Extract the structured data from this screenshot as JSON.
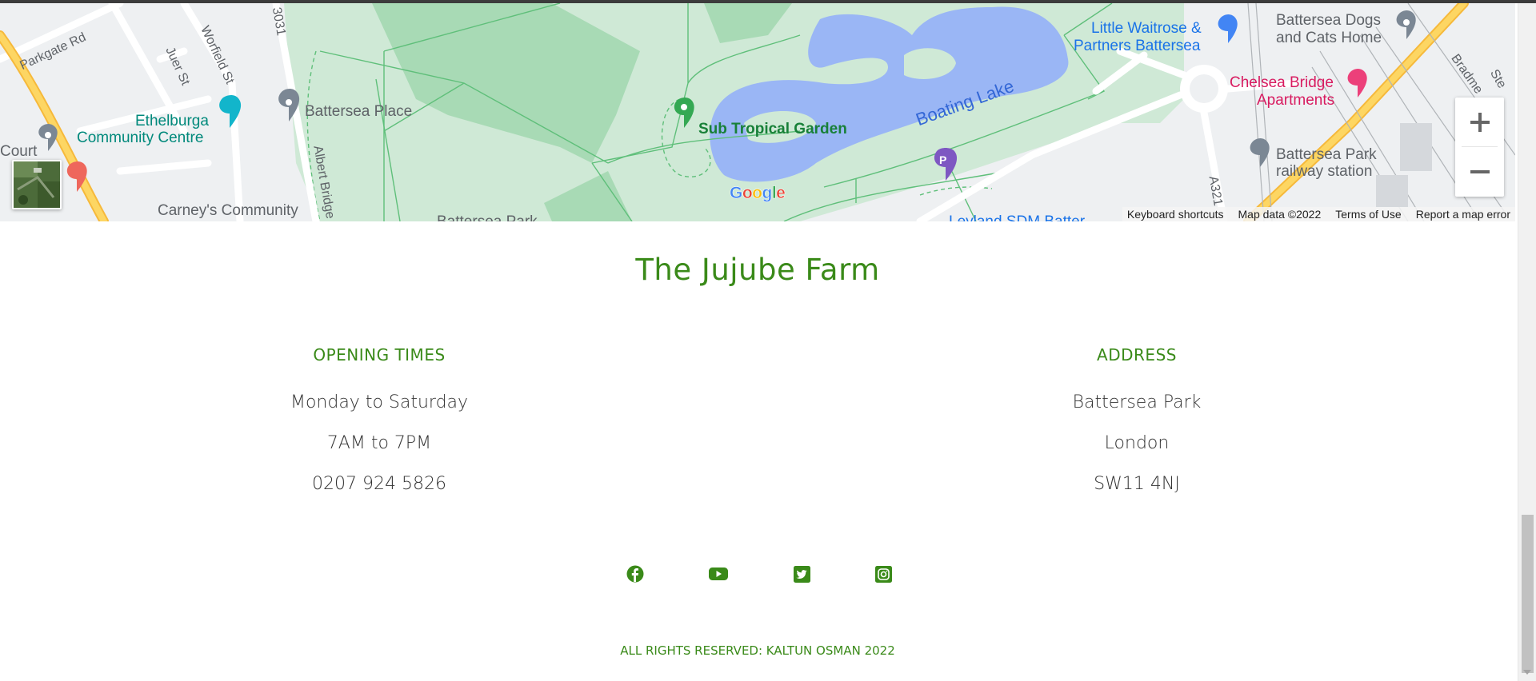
{
  "map": {
    "labels": {
      "parkgate": "Parkgate Rd",
      "juer": "Juer St",
      "worfield": "Worfield St",
      "b3031": "3031",
      "battersea_place": "Battersea Place",
      "ethelburga_1": "Ethelburga",
      "ethelburga_2": "Community Centre",
      "court": "Court",
      "albert_bridge": "Albert Bridge",
      "carneys": "Carney's Community",
      "battersea_park_cut": "Battersea Park",
      "sub_tropical": "Sub Tropical Garden",
      "boating_lake": "Boating Lake",
      "waitrose_1": "Little Waitrose &",
      "waitrose_2": "Partners Battersea",
      "dogs_cats_1": "Battersea Dogs",
      "dogs_cats_2": "and Cats Home",
      "chelsea_bridge_1": "Chelsea Bridge",
      "chelsea_bridge_2": "Apartments",
      "rail_1": "Battersea Park",
      "rail_2": "railway station",
      "a3216": "A321",
      "bradmead": "Bradme",
      "ste": "Ste",
      "leyland": "Leyland SDM Batter",
      "parking": "P"
    },
    "google_logo": [
      "G",
      "o",
      "o",
      "g",
      "l",
      "e"
    ],
    "google_colors": [
      "#4285F4",
      "#EA4335",
      "#FBBC05",
      "#4285F4",
      "#34A853",
      "#EA4335"
    ],
    "attribution": {
      "keyboard": "Keyboard shortcuts",
      "map_data": "Map data ©2022",
      "terms": "Terms of Use",
      "report": "Report a map error"
    },
    "zoom_in_icon": "plus-icon",
    "zoom_out_icon": "minus-icon",
    "colors": {
      "park": "#cfe9d6",
      "park_dark": "#a8dab5",
      "water": "#9ab6f5",
      "road_major": "#fbc94a",
      "road_minor": "#ffffff"
    }
  },
  "footer": {
    "title": "The Jujube Farm",
    "opening": {
      "heading": "OPENING TIMES",
      "days": "Monday to Saturday",
      "hours": "7AM to 7PM",
      "phone": "0207 924 5826"
    },
    "address": {
      "heading": "ADDRESS",
      "line1": "Battersea Park",
      "line2": "London",
      "line3": "SW11 4NJ"
    },
    "social_icons": [
      "facebook-icon",
      "youtube-icon",
      "twitter-icon",
      "instagram-icon"
    ],
    "copyright": "ALL RIGHTS RESERVED: KALTUN OSMAN 2022",
    "accent_color": "#3a8a19"
  }
}
